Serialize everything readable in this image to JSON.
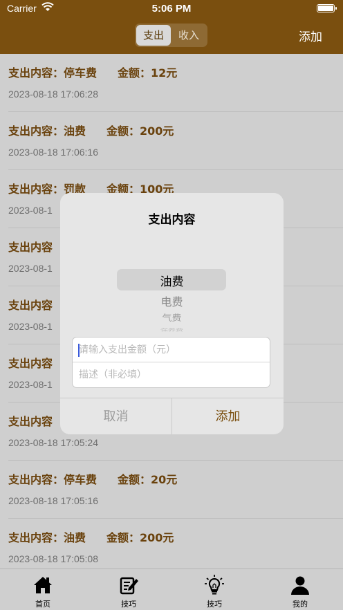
{
  "status_bar": {
    "carrier": "Carrier",
    "time": "5:06 PM"
  },
  "nav": {
    "segments": [
      "支出",
      "收入"
    ],
    "add_label": "添加"
  },
  "list": [
    {
      "content": "支出内容：停车费",
      "amount": "金额：12元",
      "time": "2023-08-18 17:06:28"
    },
    {
      "content": "支出内容：油费",
      "amount": "金额：200元",
      "time": "2023-08-18 17:06:16"
    },
    {
      "content": "支出内容：罚款",
      "amount": "金额：100元",
      "time": "2023-08-1"
    },
    {
      "content": "支出内容",
      "amount": "",
      "time": "2023-08-1"
    },
    {
      "content": "支出内容",
      "amount": "",
      "time": "2023-08-1"
    },
    {
      "content": "支出内容",
      "amount": "",
      "time": "2023-08-1"
    },
    {
      "content": "支出内容",
      "amount": "",
      "time": "2023-08-18 17:05:24"
    },
    {
      "content": "支出内容：停车费",
      "amount": "金额：20元",
      "time": "2023-08-18 17:05:16"
    },
    {
      "content": "支出内容：油费",
      "amount": "金额：200元",
      "time": "2023-08-18 17:05:08"
    }
  ],
  "dialog": {
    "title": "支出内容",
    "picker_options": [
      "油费",
      "电费",
      "气费",
      "保养费"
    ],
    "amount_placeholder": "请输入支出金额（元）",
    "desc_placeholder": "描述（非必填）",
    "cancel_label": "取消",
    "confirm_label": "添加"
  },
  "tabs": [
    {
      "label": "首页",
      "icon": "home-icon"
    },
    {
      "label": "技巧",
      "icon": "notepad-pen-icon"
    },
    {
      "label": "技巧",
      "icon": "lightbulb-icon"
    },
    {
      "label": "我的",
      "icon": "person-icon"
    }
  ],
  "colors": {
    "brand": "#7a4f0f",
    "text_brown": "#6a420d",
    "background": "#cfcfcf"
  }
}
